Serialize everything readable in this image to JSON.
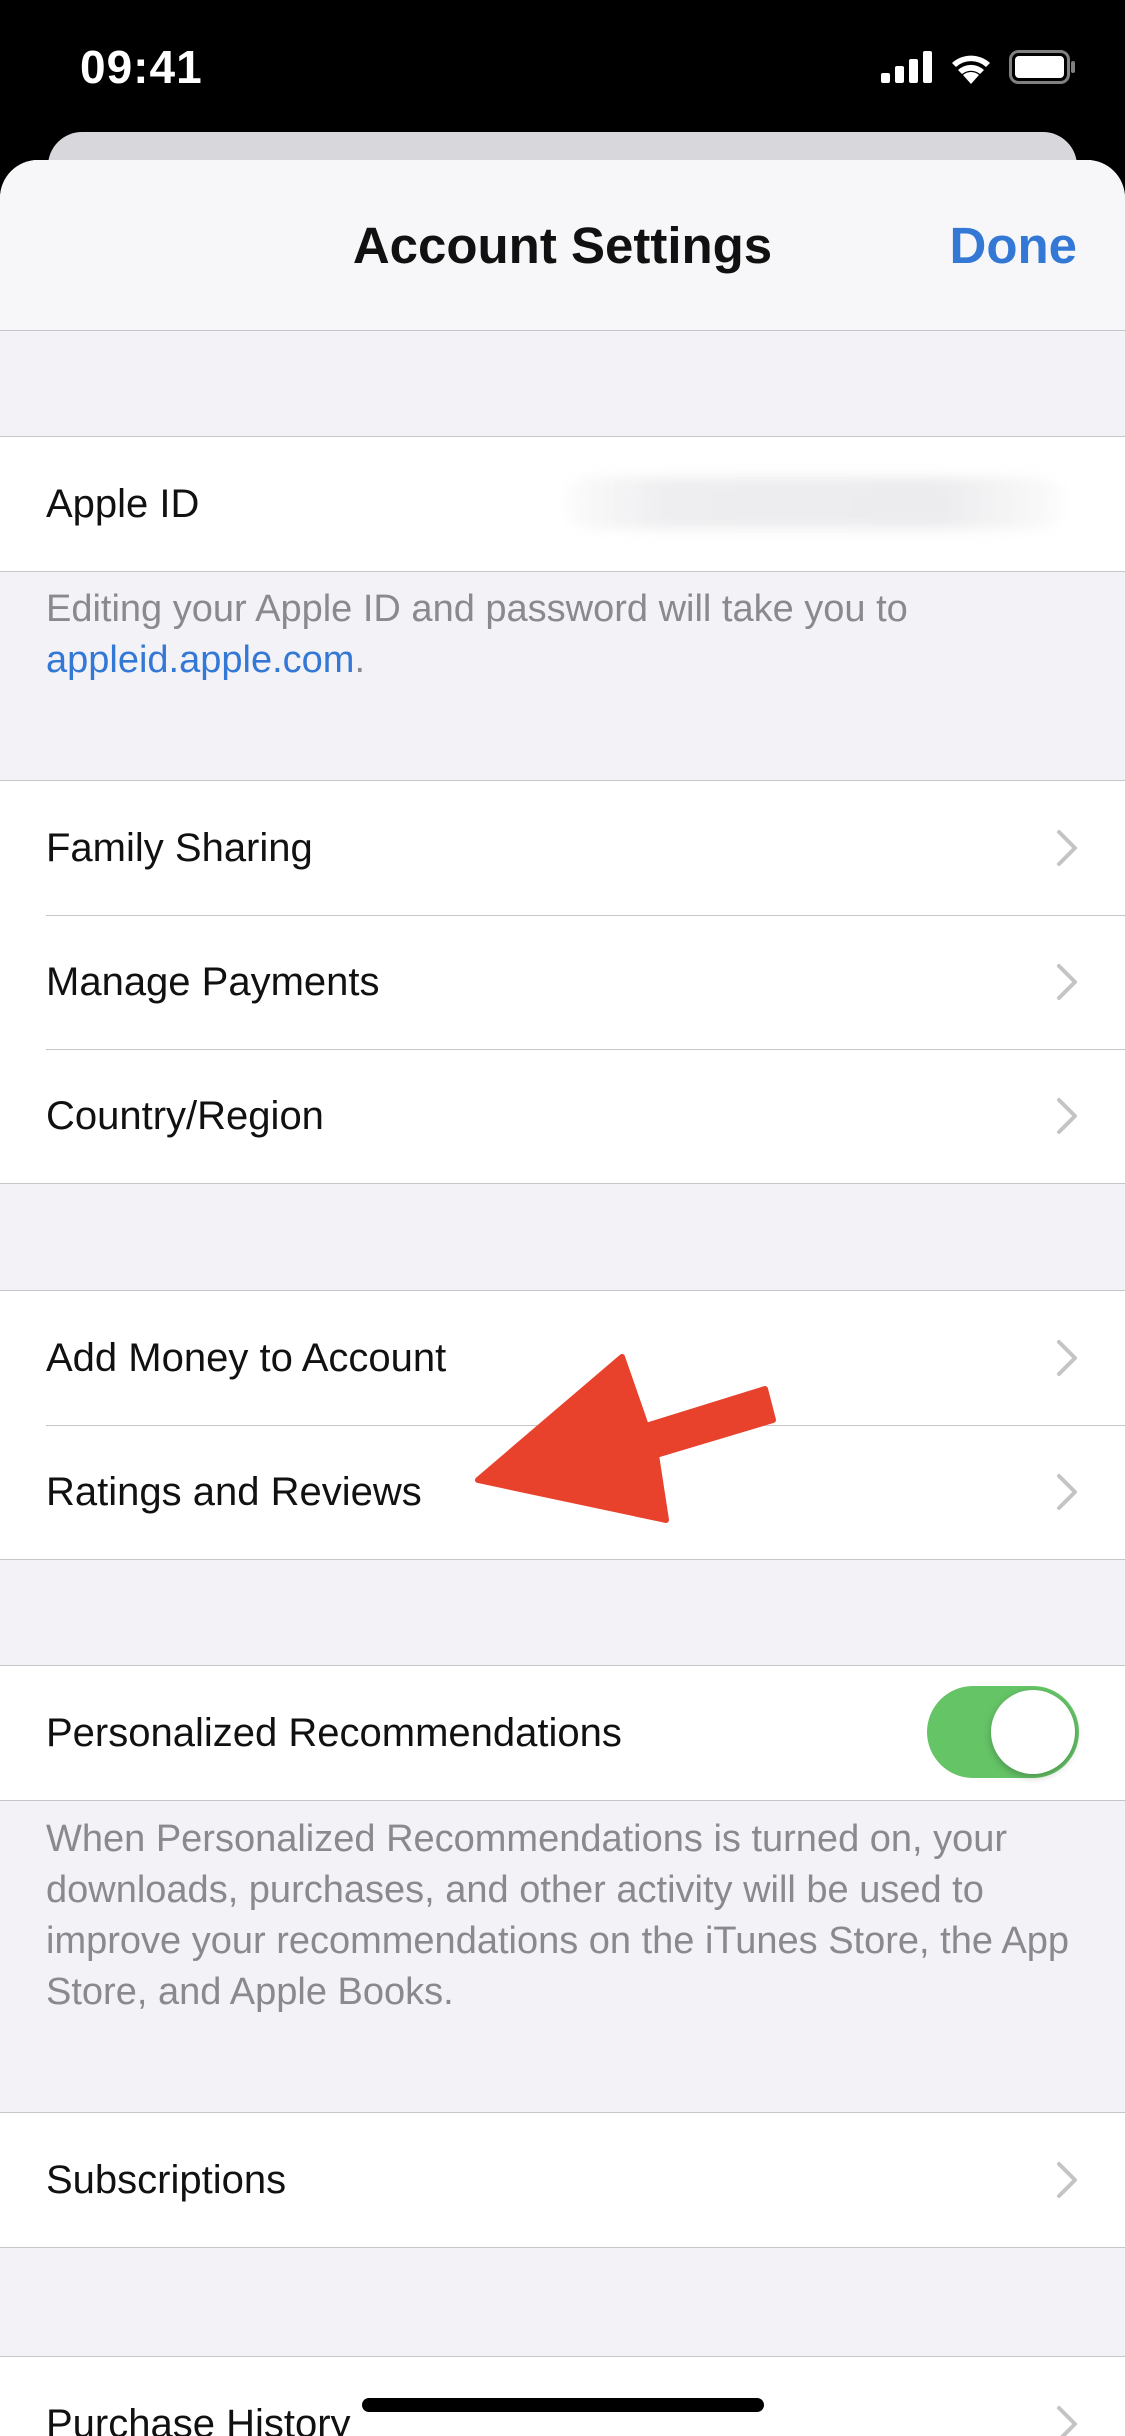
{
  "status_bar": {
    "time": "09:41"
  },
  "nav": {
    "title": "Account Settings",
    "done_label": "Done"
  },
  "apple_id": {
    "label": "Apple ID",
    "footer_text": "Editing your Apple ID and password will take you to ",
    "footer_link": "appleid.apple.com",
    "footer_end": "."
  },
  "group_family": [
    "Family Sharing",
    "Manage Payments",
    "Country/Region"
  ],
  "group_money": [
    "Add Money to Account",
    "Ratings and Reviews"
  ],
  "personalized": {
    "label": "Personalized Recommendations",
    "enabled": true,
    "footer_text": "When Personalized Recommendations is turned on, your downloads, purchases, and other activity will be used to improve your recommendations on the iTunes Store, the App Store, and Apple Books."
  },
  "subscriptions": {
    "label": "Subscriptions"
  },
  "purchase_history": {
    "label": "Purchase History"
  },
  "colors": {
    "accent": "#3478d6",
    "toggle_on": "#65c466",
    "annotation_arrow": "#e8412c",
    "group_background": "#f2f2f7"
  },
  "icons": [
    "signal-icon",
    "wifi-icon",
    "battery-icon",
    "chevron-right-icon",
    "annotation-arrow"
  ]
}
